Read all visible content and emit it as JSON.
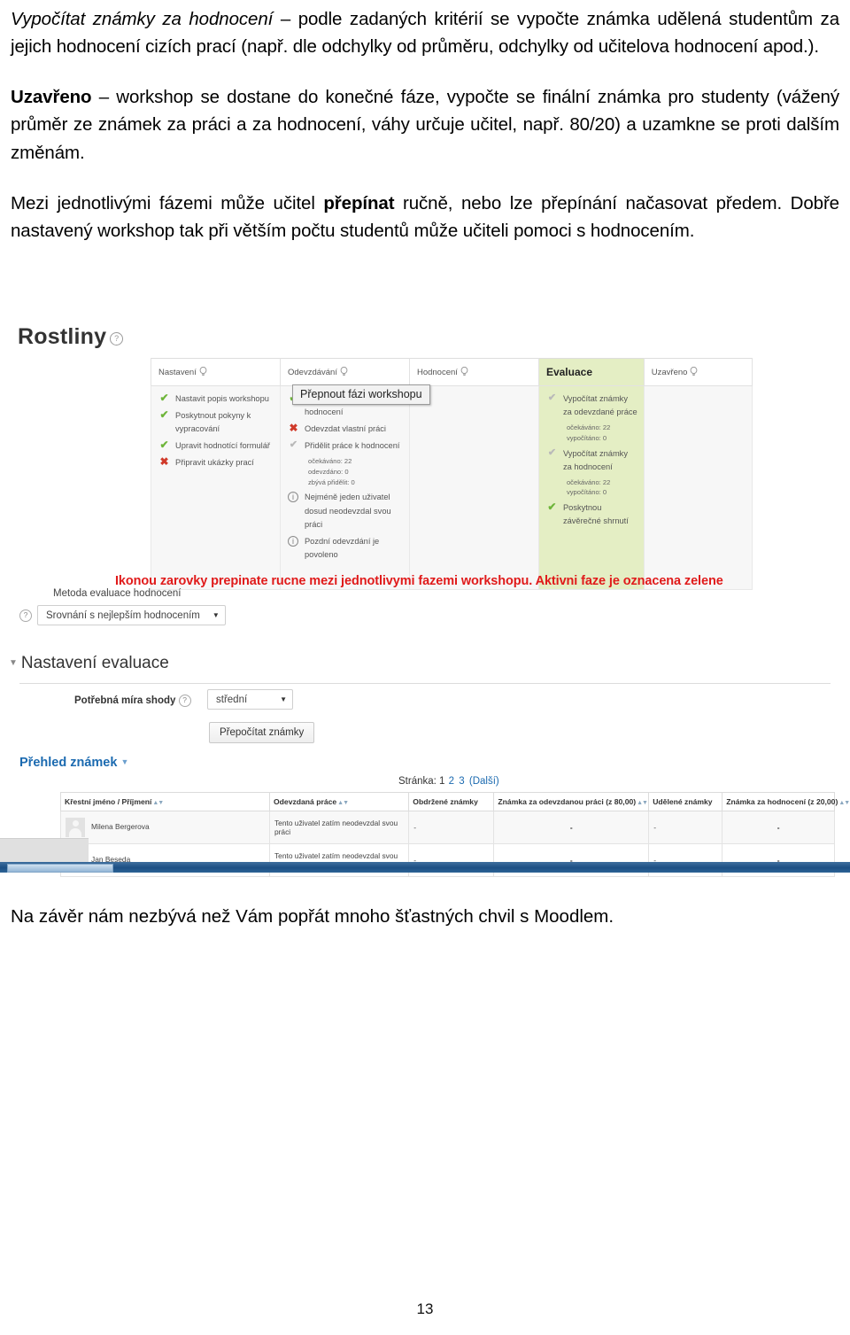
{
  "document": {
    "paragraphs": [
      {
        "id": "p1",
        "italic_lead": "Vypočítat známky za hodnocení",
        "rest": " – podle zadaných kritérií se vypočte známka udělená studentům za jejich hodnocení cizích prací (např. dle odchylky od průměru, odchylky od učitelova hodnocení apod.)."
      },
      {
        "id": "p2",
        "bold_lead": "Uzavřeno",
        "rest": " – workshop se dostane do konečné fáze, vypočte se finální známka pro studenty (vážený průměr ze známek za práci a za hodnocení, váhy určuje učitel, např. 80/20) a uzamkne se proti dalším změnám."
      },
      {
        "id": "p3",
        "part_a": "Mezi jednotlivými fázemi může učitel ",
        "bold_mid": "přepínat",
        "part_b": " ručně, nebo lze přepínání načasovat předem. Dobře nastavený workshop tak při větším počtu studentů může učiteli pomoci s hodnocením."
      }
    ],
    "closing": "Na závěr nám nezbývá než Vám popřát mnoho šťastných chvil s Moodlem.",
    "page_number": "13"
  },
  "screenshot": {
    "title": "Rostliny",
    "tooltip": "Přepnout fázi workshopu",
    "red_note": "Ikonou zarovky prepinate rucne mezi jednotlivymi fazemi workshopu. Aktivni faze je oznacena zelene",
    "active_phase_color": "#e4eec4",
    "phases": [
      {
        "header": "Nastavení",
        "active": false,
        "tasks": [
          {
            "mark": "check",
            "text": "Nastavit popis workshopu",
            "sublines": []
          },
          {
            "mark": "check",
            "text": "Poskytnout pokyny k vypracování",
            "sublines": []
          },
          {
            "mark": "check",
            "text": "Upravit hodnotící formulář",
            "sublines": []
          },
          {
            "mark": "cross",
            "text": "Připravit ukázky prací",
            "sublines": []
          }
        ]
      },
      {
        "header": "Odevzdávání",
        "active": false,
        "tasks": [
          {
            "mark": "check",
            "text": "Poskytnout pokyny k hodnocení",
            "sublines": []
          },
          {
            "mark": "cross",
            "text": "Odevzdat vlastní práci",
            "sublines": []
          },
          {
            "mark": "pale",
            "text": "Přidělit práce k hodnocení",
            "sublines": [
              "očekáváno: 22",
              "odevzdáno: 0",
              "zbývá přidělit: 0"
            ]
          },
          {
            "mark": "info",
            "text": "Nejméně jeden uživatel dosud neodevzdal svou práci",
            "sublines": []
          },
          {
            "mark": "info",
            "text": "Pozdní odevzdání je povoleno",
            "sublines": []
          }
        ]
      },
      {
        "header": "Hodnocení",
        "active": false,
        "tasks": []
      },
      {
        "header": "Evaluace",
        "active": true,
        "tasks": [
          {
            "mark": "pale",
            "text": "Vypočítat známky za odevzdané práce",
            "sublines": [
              "očekáváno: 22",
              "vypočítáno: 0"
            ]
          },
          {
            "mark": "pale",
            "text": "Vypočítat známky za hodnocení",
            "sublines": [
              "očekáváno: 22",
              "vypočítáno: 0"
            ]
          },
          {
            "mark": "check",
            "text": "Poskytnou závěrečné shrnutí",
            "sublines": []
          }
        ]
      },
      {
        "header": "Uzavřeno",
        "active": false,
        "tasks": []
      }
    ],
    "method": {
      "label": "Metoda evaluace hodnocení",
      "value": "Srovnání s nejlepším hodnocením"
    },
    "section": {
      "title": "Nastavení evaluace",
      "shody_label": "Potřebná míra shody",
      "shody_value": "střední",
      "recalc_button": "Přepočítat známky"
    },
    "grades_link": "Přehled známek",
    "pager": {
      "label": "Stránka:",
      "pages": [
        "1",
        "2",
        "3"
      ],
      "current": "1",
      "next": "(Další)"
    },
    "grades_table": {
      "columns": [
        "Křestní jméno / Příjmení",
        "Odevzdaná práce",
        "Obdržené známky",
        "Známka za odevzdanou práci (z 80,00)",
        "Udělené známky",
        "Známka za hodnocení (z 20,00)"
      ],
      "rows": [
        {
          "name": "Milena Bergerova",
          "submission": "Tento uživatel zatím neodevzdal svou práci",
          "received": "-",
          "grade_work": "-",
          "given": "-",
          "grade_assess": "-"
        },
        {
          "name": "Jan Beseda",
          "submission": "Tento uživatel zatím neodevzdal svou práci",
          "received": "-",
          "grade_work": "-",
          "given": "-",
          "grade_assess": "-"
        }
      ]
    }
  }
}
